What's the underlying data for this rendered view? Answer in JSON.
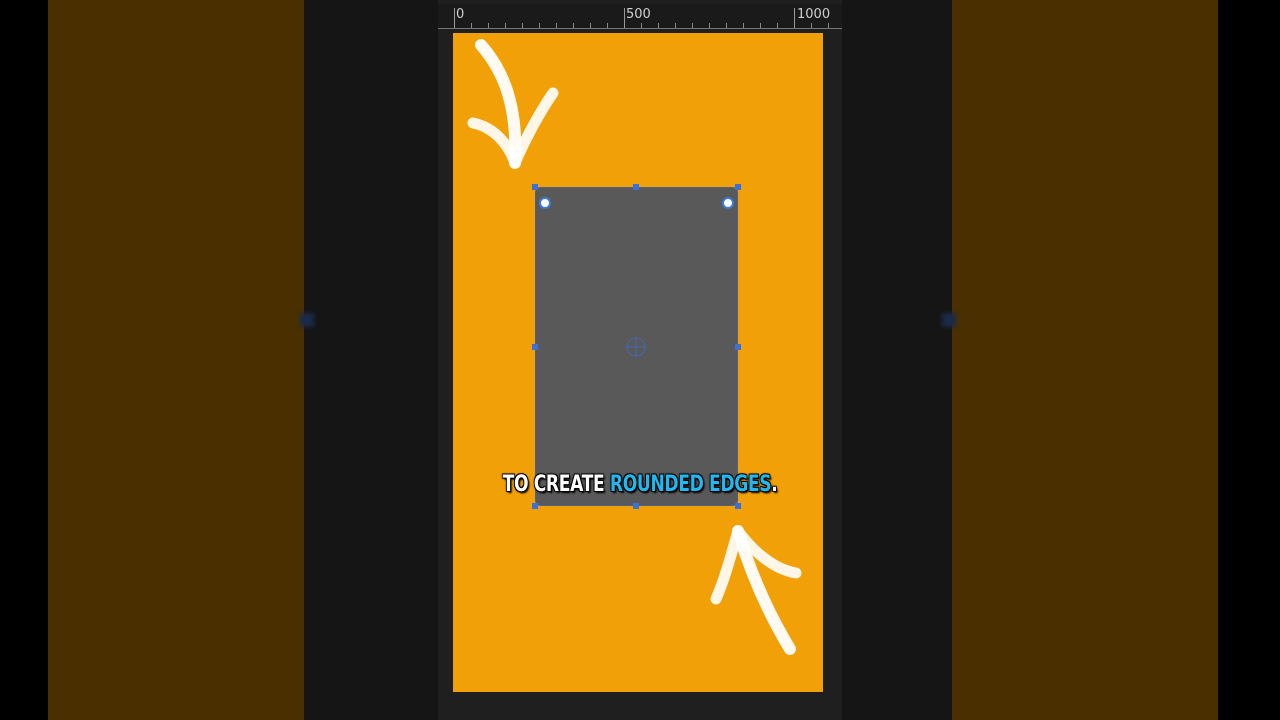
{
  "ruler": {
    "labels": [
      "0",
      "500",
      "1000"
    ]
  },
  "canvas": {
    "background_color": "#f2a007",
    "shape_color": "#595959",
    "selection_color": "#3c6fd8"
  },
  "caption": {
    "part1": "TO CREATE",
    "part2": "ROUNDED EDGES",
    "part3": ".",
    "highlight_color": "#22b8ef"
  },
  "icons": {
    "arrow_top_left": "brush-arrow-icon",
    "arrow_bottom_right": "brush-arrow-icon",
    "move_anchor": "crosshair-icon"
  }
}
